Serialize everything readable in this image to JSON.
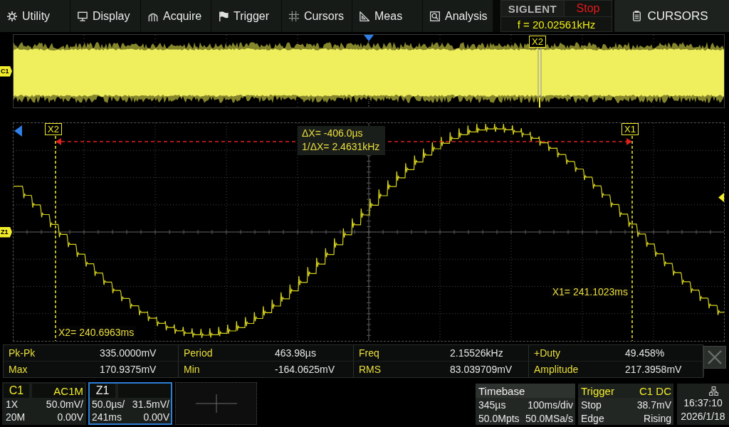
{
  "menu_bar": {
    "items": [
      {
        "label": "Utility"
      },
      {
        "label": "Display"
      },
      {
        "label": "Acquire"
      },
      {
        "label": "Trigger"
      },
      {
        "label": "Cursors"
      },
      {
        "label": "Meas"
      },
      {
        "label": "Analysis"
      }
    ]
  },
  "status_header": {
    "logo": "SIGLENT",
    "run_state": "Stop",
    "trigger_frequency": "f = 20.02561kHz"
  },
  "side_menu_button": {
    "label": "CURSORS"
  },
  "overview": {
    "channel_tag": "C1",
    "cursor_label": "X2"
  },
  "main_plot": {
    "channel_tag": "Z1",
    "cursors": [
      {
        "label": "X2",
        "readout": "X2= 240.6963ms"
      },
      {
        "label": "X1",
        "readout": "X1= 241.1023ms"
      }
    ],
    "delta_readouts": [
      "ΔX= -406.0µs",
      "1/ΔX= 2.4631kHz"
    ]
  },
  "measurements": {
    "rows": [
      [
        {
          "label": "Pk-Pk",
          "value": "335.0000mV"
        },
        {
          "label": "Period",
          "value": "463.98µs"
        },
        {
          "label": "Freq",
          "value": "2.15526kHz"
        },
        {
          "label": "+Duty",
          "value": "49.458%"
        }
      ],
      [
        {
          "label": "Max",
          "value": "170.9375mV"
        },
        {
          "label": "Min",
          "value": "-164.0625mV"
        },
        {
          "label": "RMS",
          "value": "83.039709mV"
        },
        {
          "label": "Amplitude",
          "value": "217.3958mV"
        }
      ]
    ]
  },
  "channel_panels": [
    {
      "kind": "channel",
      "name": "C1",
      "coupling": "AC1M",
      "selected": false,
      "rows": [
        [
          "1X",
          "50.0mV/"
        ],
        [
          "20M",
          "0.00V"
        ]
      ]
    },
    {
      "kind": "zoom",
      "name": "Z1",
      "selected": true,
      "rows": [
        [
          "50.0µs/",
          "31.5mV/"
        ],
        [
          "241ms",
          "0.00V"
        ]
      ]
    }
  ],
  "timebase": {
    "title": "Timebase",
    "rows": [
      [
        "345µs",
        "100ms/div"
      ],
      [
        "50.0Mpts",
        "50.0MSa/s"
      ]
    ]
  },
  "trigger": {
    "title": "Trigger",
    "source": "C1 DC",
    "rows": [
      [
        "Stop",
        "38.7mV"
      ],
      [
        "Edge",
        "Rising"
      ]
    ]
  },
  "clock": {
    "time": "16:37:10",
    "date": "2026/1/18"
  }
}
